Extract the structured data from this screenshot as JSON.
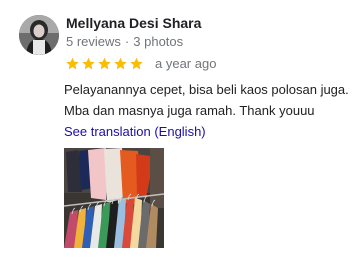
{
  "review": {
    "reviewer_name": "Mellyana Desi Shara",
    "reviews_count": "5 reviews",
    "separator": "·",
    "photos_count": "3 photos",
    "rating": 5,
    "rating_max": 5,
    "date": "a year ago",
    "text_line1": "Pelayanannya cepet, bisa beli kaos polosan juga.",
    "text_line2": "Mba dan masnya juga ramah. Thank youuu",
    "translate_link": "See translation (English)",
    "photo": {
      "icon": "clothing-rack-photo"
    }
  },
  "colors": {
    "star": "#fbbc04",
    "link": "#1a0dab",
    "meta": "#70757a",
    "text": "#202124"
  }
}
